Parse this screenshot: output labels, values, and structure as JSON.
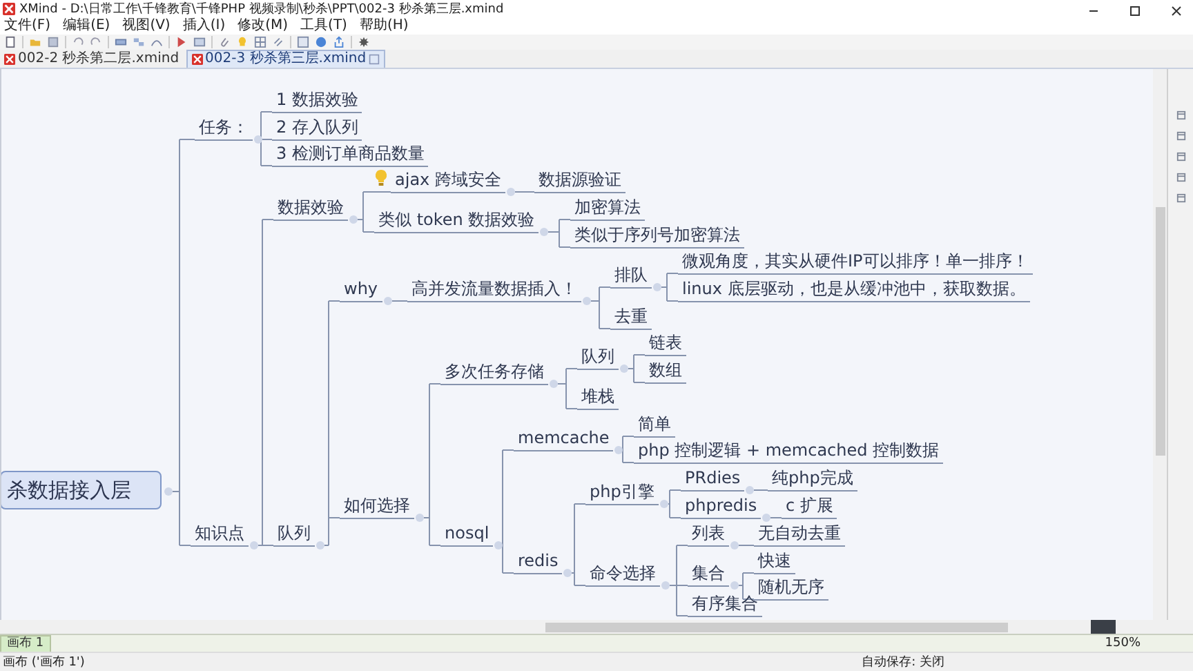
{
  "window": {
    "title": "XMind - D:\\日常工作\\千锋教育\\千锋PHP 视频录制\\秒杀\\PPT\\002-3 秒杀第三层.xmind"
  },
  "menu": [
    "文件(F)",
    "编辑(E)",
    "视图(V)",
    "插入(I)",
    "修改(M)",
    "工具(T)",
    "帮助(H)"
  ],
  "tabs": [
    {
      "label": "002-2 秒杀第二层.xmind",
      "selected": false
    },
    {
      "label": "002-3 秒杀第三层.xmind",
      "selected": true
    }
  ],
  "mind_map": {
    "root": {
      "label": "杀数据接入层",
      "children": [
        {
          "label": "任务：",
          "children": [
            {
              "label": "1 数据效验"
            },
            {
              "label": "2 存入队列"
            },
            {
              "label": "3 检测订单商品数量"
            }
          ]
        },
        {
          "label": "知识点",
          "children": [
            {
              "label": "数据效验",
              "children": [
                {
                  "label": "ajax 跨域安全",
                  "idea_marker": true,
                  "children": [
                    {
                      "label": "数据源验证"
                    }
                  ]
                },
                {
                  "label": "类似 token 数据效验",
                  "children": [
                    {
                      "label": "加密算法"
                    },
                    {
                      "label": "类似于序列号加密算法"
                    }
                  ]
                }
              ]
            },
            {
              "label": "队列",
              "children": [
                {
                  "label": "why",
                  "children": [
                    {
                      "label": "高并发流量数据插入！",
                      "children": [
                        {
                          "label": "排队",
                          "children": [
                            {
                              "label": "微观角度，其实从硬件IP可以排序！单一排序！"
                            },
                            {
                              "label": "linux 底层驱动，也是从缓冲池中，获取数据。"
                            }
                          ]
                        },
                        {
                          "label": "去重"
                        }
                      ]
                    }
                  ]
                },
                {
                  "label": "如何选择",
                  "children": [
                    {
                      "label": "多次任务存储",
                      "children": [
                        {
                          "label": "队列",
                          "children": [
                            {
                              "label": "链表"
                            },
                            {
                              "label": "数组"
                            }
                          ]
                        },
                        {
                          "label": "堆栈"
                        }
                      ]
                    },
                    {
                      "label": "nosql",
                      "children": [
                        {
                          "label": "memcache",
                          "children": [
                            {
                              "label": "简单"
                            },
                            {
                              "label": "php 控制逻辑 + memcached 控制数据"
                            }
                          ]
                        },
                        {
                          "label": "redis",
                          "children": [
                            {
                              "label": "php引擎",
                              "children": [
                                {
                                  "label": "PRdies",
                                  "children": [
                                    {
                                      "label": "纯php完成"
                                    }
                                  ]
                                },
                                {
                                  "label": "phpredis",
                                  "children": [
                                    {
                                      "label": "c 扩展"
                                    }
                                  ]
                                }
                              ]
                            },
                            {
                              "label": "命令选择",
                              "children": [
                                {
                                  "label": "列表",
                                  "children": [
                                    {
                                      "label": "无自动去重"
                                    }
                                  ]
                                },
                                {
                                  "label": "集合",
                                  "children": [
                                    {
                                      "label": "快速"
                                    },
                                    {
                                      "label": "随机无序"
                                    }
                                  ]
                                },
                                {
                                  "label": "有序集合"
                                }
                              ]
                            }
                          ]
                        }
                      ]
                    }
                  ]
                }
              ]
            }
          ]
        }
      ]
    }
  },
  "sheet_tabs": [
    {
      "label": "画布 1",
      "selected": true
    }
  ],
  "status_bar": {
    "sheet": "画布 ('画布 1')",
    "autosave": "自动保存: 关闭",
    "zoom": "150%"
  }
}
